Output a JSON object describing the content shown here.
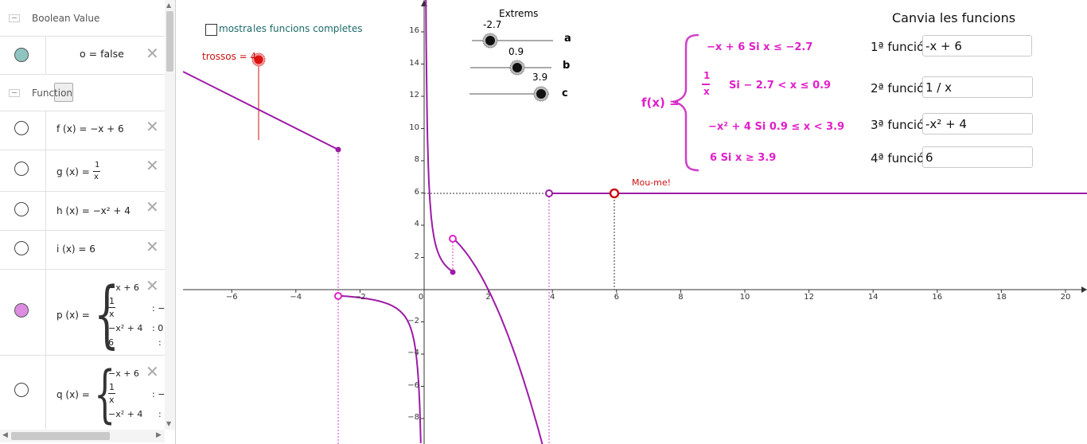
{
  "algebra": {
    "groups": {
      "boolean": "Boolean Value",
      "function": "Function"
    },
    "boolean_item": {
      "expr": "o = false"
    },
    "functions": [
      {
        "expr": "f (x)  =  −x + 6"
      },
      {
        "expr_prefix": "g (x)  =",
        "num": "1",
        "den": "x"
      },
      {
        "expr": "h (x)  =  −x² + 4"
      },
      {
        "expr": "i (x)  =  6"
      }
    ],
    "p": {
      "name": "p (x)  =",
      "pieces": [
        "−x + 6",
        "1",
        "x",
        "−x² + 4",
        "6"
      ],
      "cond": [
        ": −",
        ": 0",
        ": o"
      ]
    },
    "q": {
      "name": "q (x)  =",
      "pieces": [
        "−x + 6",
        "1",
        "x",
        "−x² + 4"
      ],
      "cond": [
        ": −",
        ": o"
      ]
    },
    "delete_glyph": "✕",
    "colors": {
      "accent_teal": "#8fc5c1",
      "accent_pink": "#dc8de0"
    }
  },
  "graph": {
    "checkbox_label_1": "mostra",
    "checkbox_label_2": "les funcions completes",
    "trossos_label": "trossos = 4",
    "extrems_title": "Extrems",
    "sliders": [
      {
        "name": "a",
        "value": "-2.7"
      },
      {
        "name": "b",
        "value": "0.9"
      },
      {
        "name": "c",
        "value": "3.9"
      }
    ],
    "moume": "Mou-me!",
    "fx_label": "f(x) =",
    "fx_pieces": [
      "−x + 6    Si    x ≤ −2.7",
      "Si    − 2.7 < x ≤ 0.9",
      "−x² + 4    Si   0.9 ≤ x < 3.9",
      "6    Si   x ≥ 3.9"
    ],
    "fx_frac_num": "1",
    "fx_frac_den": "x",
    "canvia_title": "Canvia les funcions",
    "inputs": [
      {
        "label": "1ª funció",
        "value": "-x + 6"
      },
      {
        "label": "2ª funció",
        "value": "1 / x"
      },
      {
        "label": "3ª funció",
        "value": "-x² + 4"
      },
      {
        "label": "4ª funció",
        "value": "6"
      }
    ],
    "x_ticks": [
      "−6",
      "−4",
      "−2",
      "0",
      "2",
      "4",
      "6",
      "8",
      "10",
      "12",
      "14",
      "16",
      "18",
      "20"
    ],
    "y_ticks": [
      "16",
      "14",
      "12",
      "10",
      "8",
      "6",
      "4",
      "2",
      "−2",
      "−4",
      "−6",
      "−8"
    ],
    "colors": {
      "curve": "#9c1ba6",
      "pink": "#e020c8",
      "red": "#cc1111",
      "teal": "#1b6b68"
    }
  }
}
